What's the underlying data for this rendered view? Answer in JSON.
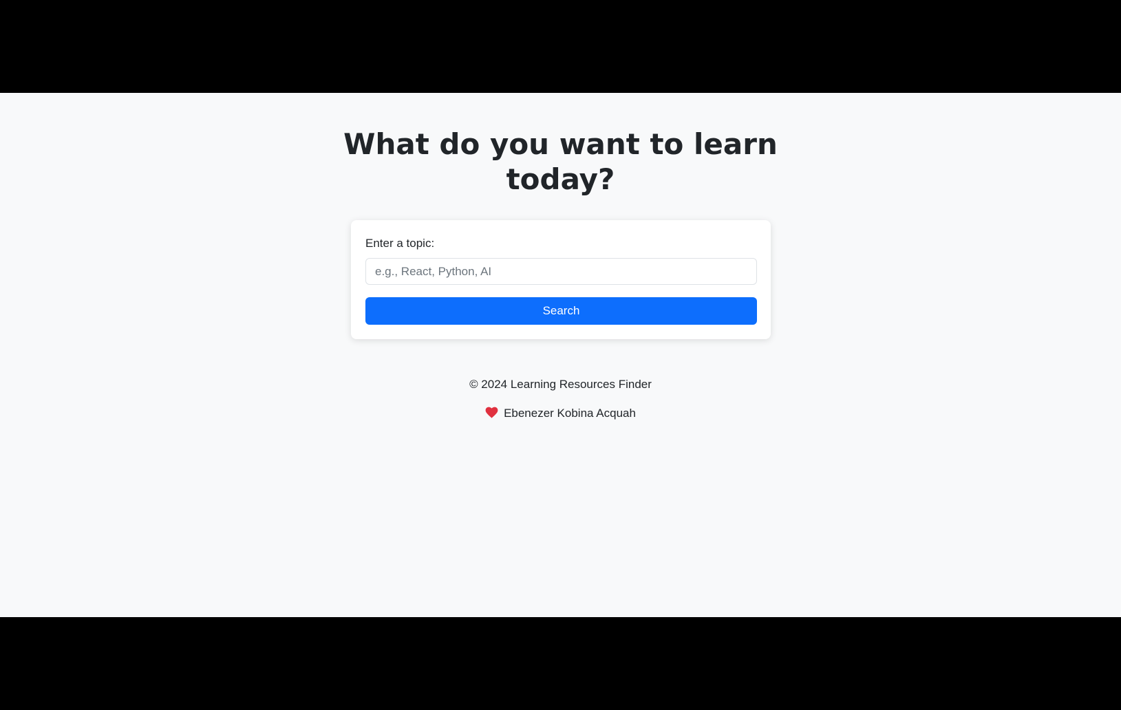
{
  "page": {
    "headline_line1": "What do you want to learn",
    "headline_line2": "today?"
  },
  "search_form": {
    "label": "Enter a topic:",
    "input_value": "",
    "input_placeholder": "e.g., React, Python, AI",
    "button_label": "Search"
  },
  "footer": {
    "copyright": "© 2024 Learning Resources Finder",
    "author_icon": "heart-icon",
    "author_name": "Ebenezer Kobina Acquah"
  },
  "colors": {
    "page_background": "#f8f9fa",
    "primary_button": "#0d6efd",
    "heart": "#e0313f",
    "text": "#212529"
  }
}
